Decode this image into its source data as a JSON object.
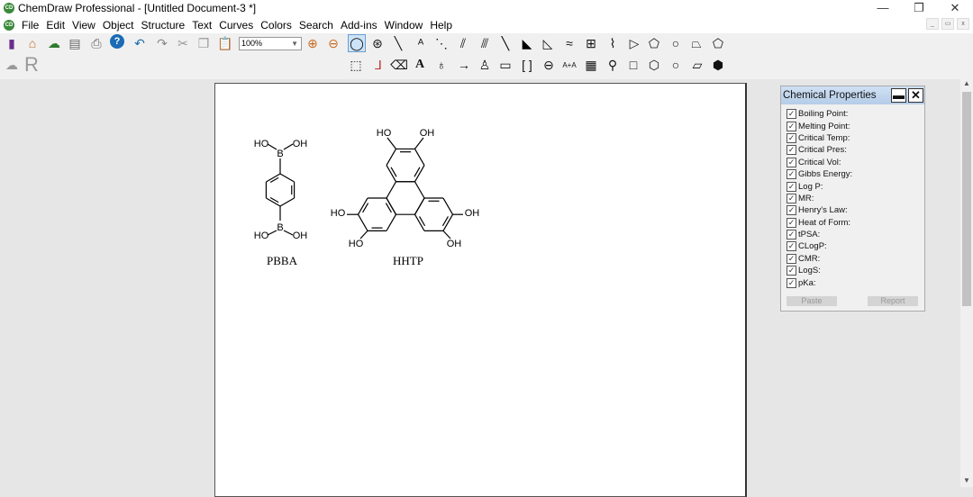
{
  "window": {
    "title": "ChemDraw Professional - [Untitled Document-3 *]",
    "app_icon": "CD"
  },
  "menu": [
    "File",
    "Edit",
    "View",
    "Object",
    "Structure",
    "Text",
    "Curves",
    "Colors",
    "Search",
    "Add-ins",
    "Window",
    "Help"
  ],
  "toolbar": {
    "zoom_value": "100%",
    "row1_icons": [
      "new-document",
      "open",
      "cloud",
      "save",
      "print",
      "help",
      "undo",
      "redo",
      "cut",
      "copy",
      "paste",
      "zoom-in",
      "zoom-out",
      "lasso",
      "rotate",
      "bond",
      "any-bond",
      "dashed-bond",
      "hashed-bond",
      "hashed-wedge",
      "bold-bond",
      "wedge-bond",
      "hollow-wedge",
      "wavy-bond",
      "table",
      "chain",
      "triangle",
      "pentagon",
      "heptagon",
      "chair",
      "cyclopentadiene"
    ],
    "row2_icons": [
      "marquee",
      "structure-perspective",
      "eraser",
      "text",
      "orbital",
      "arrow",
      "pen",
      "rectangle",
      "brackets",
      "charge",
      "mapping",
      "template",
      "stamp",
      "cyclobutane",
      "cyclohexane",
      "cyclooctane",
      "chair-cyclohexane",
      "benzene"
    ],
    "text_tool": "A",
    "mapping": "A+A"
  },
  "molecules": {
    "pbba": {
      "name": "PBBA",
      "labels": {
        "b_top": "B",
        "b_bottom": "B",
        "ho_tl": "HO",
        "oh_tr": "OH",
        "ho_bl": "HO",
        "oh_br": "OH"
      }
    },
    "hhtp": {
      "name": "HHTP",
      "labels": {
        "ho_t1": "HO",
        "oh_t2": "OH",
        "ho_l1": "HO",
        "ho_l2": "HO",
        "oh_r1": "OH",
        "oh_r2": "OH"
      }
    }
  },
  "panel": {
    "title": "Chemical Properties",
    "properties": [
      "Boiling Point:",
      "Melting Point:",
      "Critical Temp:",
      "Critical Pres:",
      "Critical Vol:",
      "Gibbs Energy:",
      "Log P:",
      "MR:",
      "Henry's Law:",
      "Heat of Form:",
      "tPSA:",
      "CLogP:",
      "CMR:",
      "LogS:",
      "pKa:"
    ],
    "checked": true,
    "paste": "Paste",
    "report": "Report"
  }
}
